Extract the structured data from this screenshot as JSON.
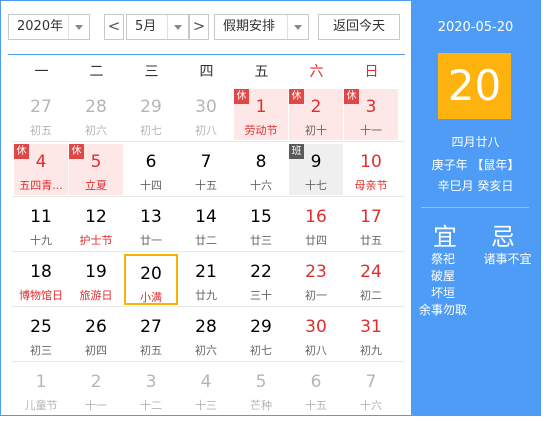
{
  "toolbar": {
    "year": "2020年",
    "month": "5月",
    "prev": "<",
    "next": ">",
    "holiday": "假期安排",
    "today_btn": "返回今天"
  },
  "weekdays": [
    "一",
    "二",
    "三",
    "四",
    "五",
    "六",
    "日"
  ],
  "badges": {
    "rest": "休",
    "work": "班"
  },
  "days": [
    [
      {
        "n": "27",
        "l": "初五",
        "gray": true
      },
      {
        "n": "28",
        "l": "初六",
        "gray": true
      },
      {
        "n": "29",
        "l": "初七",
        "gray": true
      },
      {
        "n": "30",
        "l": "初八",
        "gray": true
      },
      {
        "n": "1",
        "l": "劳动节",
        "hol": true,
        "fest": true
      },
      {
        "n": "2",
        "l": "初十",
        "hol": true
      },
      {
        "n": "3",
        "l": "十一",
        "hol": true
      }
    ],
    [
      {
        "n": "4",
        "l": "五四青...",
        "hol": true,
        "fest": true
      },
      {
        "n": "5",
        "l": "立夏",
        "hol": true,
        "fest": true
      },
      {
        "n": "6",
        "l": "十四"
      },
      {
        "n": "7",
        "l": "十五"
      },
      {
        "n": "8",
        "l": "十六"
      },
      {
        "n": "9",
        "l": "十七",
        "work": true
      },
      {
        "n": "10",
        "l": "母亲节",
        "red": true,
        "fest": true
      }
    ],
    [
      {
        "n": "11",
        "l": "十九"
      },
      {
        "n": "12",
        "l": "护士节",
        "fest": true
      },
      {
        "n": "13",
        "l": "廿一"
      },
      {
        "n": "14",
        "l": "廿二"
      },
      {
        "n": "15",
        "l": "廿三"
      },
      {
        "n": "16",
        "l": "廿四",
        "red": true
      },
      {
        "n": "17",
        "l": "廿五",
        "red": true
      }
    ],
    [
      {
        "n": "18",
        "l": "博物馆日",
        "fest": true
      },
      {
        "n": "19",
        "l": "旅游日",
        "fest": true
      },
      {
        "n": "20",
        "l": "小满",
        "fest": true,
        "today": true
      },
      {
        "n": "21",
        "l": "廿九"
      },
      {
        "n": "22",
        "l": "三十"
      },
      {
        "n": "23",
        "l": "初一",
        "red": true
      },
      {
        "n": "24",
        "l": "初二",
        "red": true
      }
    ],
    [
      {
        "n": "25",
        "l": "初三"
      },
      {
        "n": "26",
        "l": "初四"
      },
      {
        "n": "27",
        "l": "初五"
      },
      {
        "n": "28",
        "l": "初六"
      },
      {
        "n": "29",
        "l": "初七"
      },
      {
        "n": "30",
        "l": "初八",
        "red": true
      },
      {
        "n": "31",
        "l": "初九",
        "red": true
      }
    ],
    [
      {
        "n": "1",
        "l": "儿童节",
        "gray": true
      },
      {
        "n": "2",
        "l": "十一",
        "gray": true
      },
      {
        "n": "3",
        "l": "十二",
        "gray": true
      },
      {
        "n": "4",
        "l": "十三",
        "gray": true
      },
      {
        "n": "5",
        "l": "芒种",
        "gray": true
      },
      {
        "n": "6",
        "l": "十五",
        "gray": true
      },
      {
        "n": "7",
        "l": "十六",
        "gray": true
      }
    ]
  ],
  "panel": {
    "date": "2020-05-20",
    "day": "20",
    "lunar": "四月廿八",
    "ganzhi_year": "庚子年 【鼠年】",
    "ganzhi_day": "辛巳月 癸亥日",
    "yi": "宜",
    "ji": "忌",
    "yi_items": [
      "祭祀",
      "破屋",
      "坏垣",
      "余事勿取"
    ],
    "ji_items": [
      "诸事不宜"
    ]
  }
}
